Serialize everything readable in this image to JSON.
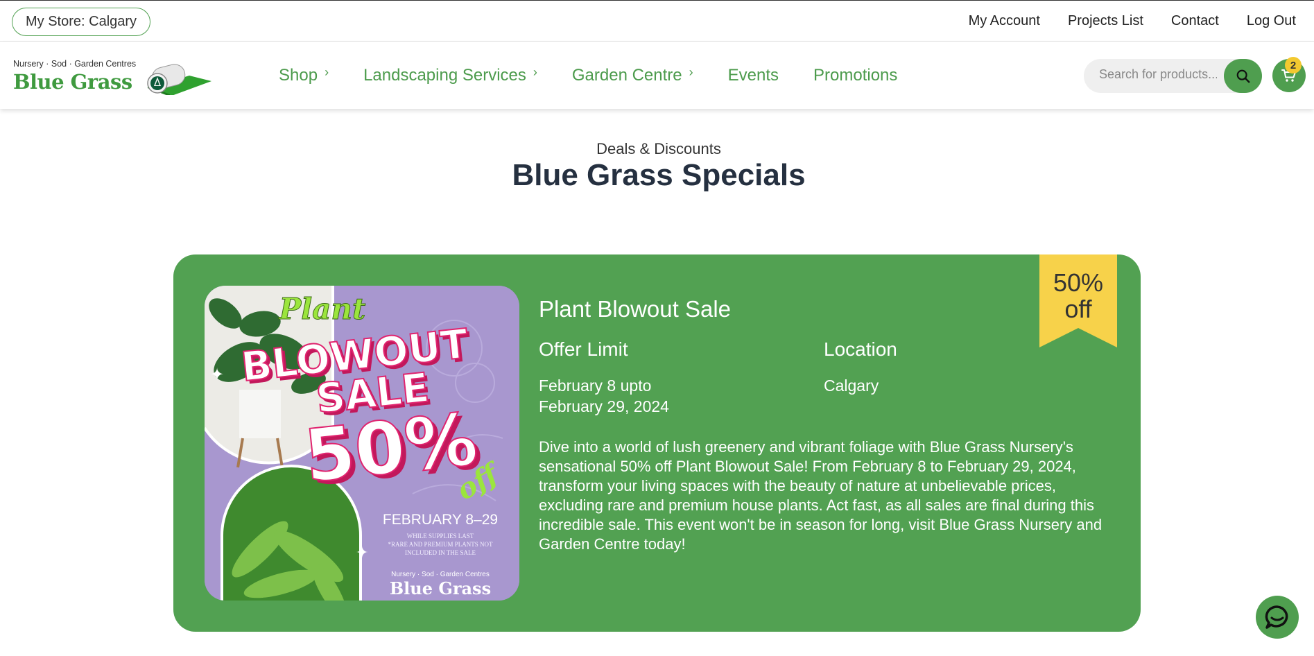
{
  "topbar": {
    "store_label": "My Store: Calgary",
    "links": [
      "My Account",
      "Projects List",
      "Contact",
      "Log Out"
    ]
  },
  "header": {
    "logo_tagline": "Nursery · Sod · Garden Centres",
    "logo_name": "Blue Grass",
    "nav": [
      "Shop",
      "Landscaping Services",
      "Garden Centre",
      "Events",
      "Promotions"
    ],
    "search_placeholder": "Search for products...",
    "cart_count": "2"
  },
  "page": {
    "eyebrow": "Deals & Discounts",
    "title": "Blue Grass Specials"
  },
  "promo": {
    "title": "Plant Blowout Sale",
    "offer_limit_label": "Offer Limit",
    "offer_limit_value_line1": "February 8 upto",
    "offer_limit_value_line2": "February 29, 2024",
    "location_label": "Location",
    "location_value": "Calgary",
    "description": "Dive into a world of lush greenery and vibrant foliage with Blue Grass Nursery's sensational 50% off Plant Blowout Sale! From February 8 to February 29, 2024, transform your living spaces with the beauty of nature at unbelievable prices, excluding rare and premium house plants. Act fast, as all sales are final during this incredible sale. This event won't be in season for long, visit Blue Grass Nursery and Garden Centre today!",
    "ribbon_line1": "50%",
    "ribbon_line2": "off",
    "image": {
      "script_word": "Plant",
      "headline_1": "BLOWOUT",
      "headline_2": "SALE",
      "percent": "50%",
      "off": "off",
      "dates": "FEBRUARY 8–29",
      "fine_1": "WHILE SUPPLIES LAST",
      "fine_2": "*RARE AND PREMIUM PLANTS NOT",
      "fine_3": "INCLUDED IN THE SALE",
      "brand_tagline": "Nursery · Sod · Garden Centres",
      "brand_name": "Blue Grass"
    }
  },
  "colors": {
    "brand_green": "#52a152",
    "ribbon_yellow": "#f7d24a",
    "promo_purple": "#a897cf",
    "promo_pink": "#e0246f"
  },
  "icons": [
    "search-icon",
    "cart-icon",
    "chevron-right-icon",
    "chat-icon"
  ]
}
